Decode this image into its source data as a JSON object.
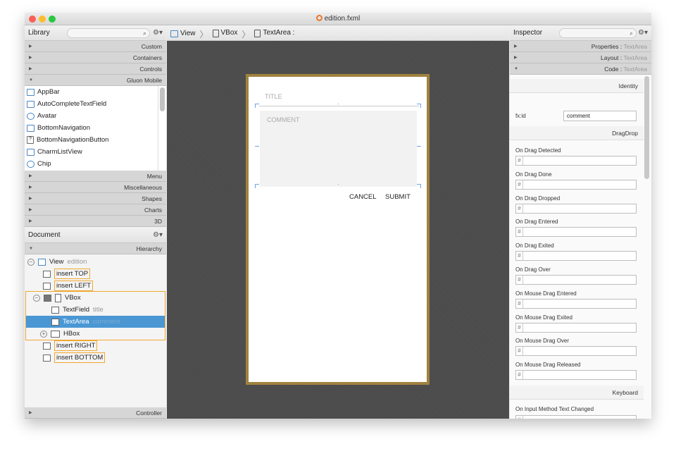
{
  "window": {
    "title": "edition.fxml",
    "file_icon": "fxml-file-icon"
  },
  "library": {
    "title": "Library",
    "search_placeholder": "",
    "sections_top": [
      "Custom",
      "Containers",
      "Controls",
      "Gluon Mobile"
    ],
    "items": [
      {
        "label": "AppBar",
        "icon": "appbar-icon"
      },
      {
        "label": "AutoCompleteTextField",
        "icon": "textfield-icon"
      },
      {
        "label": "Avatar",
        "icon": "avatar-icon"
      },
      {
        "label": "BottomNavigation",
        "icon": "bottom-navigation-icon"
      },
      {
        "label": "BottomNavigationButton",
        "icon": "question-icon"
      },
      {
        "label": "CharmListView",
        "icon": "list-icon"
      },
      {
        "label": "Chip",
        "icon": "chip-icon"
      }
    ],
    "sections_bottom": [
      "Menu",
      "Miscellaneous",
      "Shapes",
      "Charts",
      "3D"
    ]
  },
  "breadcrumb": [
    "View",
    "VBox",
    "TextArea :"
  ],
  "document": {
    "title": "Document",
    "hierarchy_label": "Hierarchy",
    "controller_label": "Controller",
    "tree": [
      {
        "label": "View",
        "sub": "edition"
      },
      {
        "label": "insert TOP"
      },
      {
        "label": "insert LEFT"
      },
      {
        "label": "VBox"
      },
      {
        "label": "TextField",
        "sub": "title"
      },
      {
        "label": "TextArea",
        "sub": "comment"
      },
      {
        "label": "HBox"
      },
      {
        "label": "insert RIGHT"
      },
      {
        "label": "insert BOTTOM"
      }
    ]
  },
  "canvas": {
    "title_placeholder": "TITLE",
    "comment_placeholder": "COMMENT",
    "cancel": "CANCEL",
    "submit": "SUBMIT"
  },
  "inspector": {
    "title": "Inspector",
    "sections": [
      {
        "name": "Properties",
        "target": "TextArea"
      },
      {
        "name": "Layout",
        "target": "TextArea"
      },
      {
        "name": "Code",
        "target": "TextArea"
      }
    ],
    "identity": "Identity",
    "fxid_label": "fx:id",
    "fxid_value": "comment",
    "dragdrop": "DragDrop",
    "hash": "#",
    "events": [
      "On Drag Detected",
      "On Drag Done",
      "On Drag Dropped",
      "On Drag Entered",
      "On Drag Exited",
      "On Drag Over",
      "On Mouse Drag Entered",
      "On Mouse Drag Exited",
      "On Mouse Drag Over",
      "On Mouse Drag Released"
    ],
    "keyboard": "Keyboard",
    "keyboard_events": [
      "On Input Method Text Changed"
    ]
  },
  "colors": {
    "selection": "#4a97d4",
    "insert_border": "#f0a830",
    "device_frame": "#a0823f",
    "handle": "#6fa3e6"
  }
}
